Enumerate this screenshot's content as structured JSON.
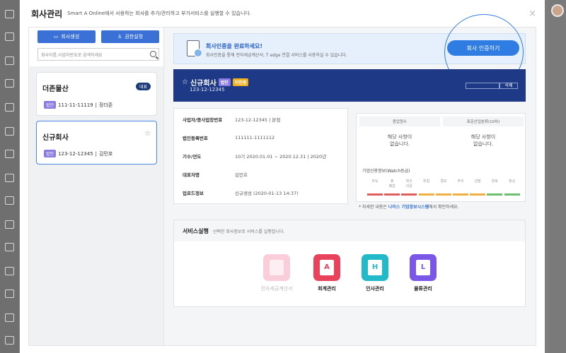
{
  "header": {
    "title": "회사관리",
    "subtitle": "Smart A Online에서 사용하는 회사를 추가/관리하고 부가서비스를 실행할 수 있습니다.",
    "close_label": "×"
  },
  "left_panel": {
    "create_button": "회사생성",
    "permission_button": "권한설정",
    "search_placeholder": "회사이름,사업자번호로 검색하세요",
    "companies": [
      {
        "name": "더존물산",
        "tag": "대표",
        "biz_type": "법인",
        "biz_number": "111-11-11119",
        "owner": "장더존",
        "selected": false
      },
      {
        "name": "신규회사",
        "tag": "☆",
        "biz_type": "법인",
        "biz_number": "123-12-12345",
        "owner": "김민호",
        "selected": true
      }
    ]
  },
  "banner": {
    "title": "회사인증을 완료하세요!",
    "description": "회사인증을 통해 전자세금계산서, T edge 연결 서비스를 사용하실 수 있습니다.",
    "button": "회사 인증하기"
  },
  "company_header": {
    "star": "☆",
    "name": "신규회사",
    "type_badge": "법인",
    "status_badge": "미인증",
    "biz_number": "123-12-12345",
    "delete_label": "삭제"
  },
  "info_rows": [
    {
      "label": "사업자/종사업장번호",
      "value": "123-12-12345 | 본점"
    },
    {
      "label": "법인등록번호",
      "value": "111111-1111112"
    },
    {
      "label": "기수/연도",
      "value": "10기 2020.01.01 ~ 2020.12.31 | 2020년"
    },
    {
      "label": "대표자명",
      "value": "김민호"
    },
    {
      "label": "업로드정보",
      "value": "신규생성 (2020-01-13 14:37)"
    }
  ],
  "stats": {
    "employees_header": "종업원수",
    "industry_header": "표준산업분류(10차)",
    "no_data_line1": "해당 사항이",
    "no_data_line2": "없습니다.",
    "watch_title": "기업신용정보(Watch등급)",
    "levels": [
      "부도",
      "휴\n폐업",
      "회수\n의문",
      "위험",
      "경보",
      "주의",
      "관찰",
      "양호",
      "정상"
    ],
    "level_colors": [
      "#e25c5c",
      "#e25c5c",
      "#e25c5c",
      "#f0b040",
      "#f0b040",
      "#f0b040",
      "#f0b040",
      "#6cc06c",
      "#6cc06c"
    ]
  },
  "note": {
    "prefix": "* 자세한 내용은",
    "link": "나이스 기업정보시스템",
    "suffix": "에서 확인하세요."
  },
  "services": {
    "title": "서비스실행",
    "description": "선택한 회사정보로 서비스를 실행합니다.",
    "apps": [
      {
        "label": "전자세금계산서",
        "glyph": "",
        "color": "#f7b8c9",
        "enabled": false
      },
      {
        "label": "회계관리",
        "glyph": "A",
        "color": "#e8425c",
        "enabled": true
      },
      {
        "label": "인사관리",
        "glyph": "H",
        "color": "#22b9c9",
        "enabled": true
      },
      {
        "label": "물류관리",
        "glyph": "L",
        "color": "#7a57e6",
        "enabled": true
      }
    ]
  }
}
